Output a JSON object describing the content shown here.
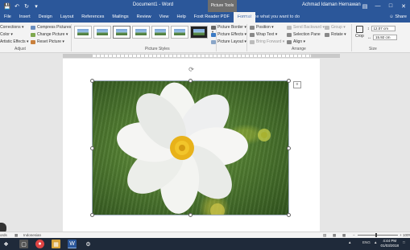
{
  "titlebar": {
    "doc_title": "Document1 - Word",
    "context_group": "Picture Tools",
    "user": "Achmad Idaman Hernawan",
    "qat_icons": [
      "save-icon",
      "undo-icon",
      "redo-icon"
    ],
    "win_minimize": "—",
    "win_maximize": "□",
    "win_close": "✕"
  },
  "tabs": [
    "File",
    "Insert",
    "Design",
    "Layout",
    "References",
    "Mailings",
    "Review",
    "View",
    "Help",
    "Foxit Reader PDF",
    "Format"
  ],
  "active_tab": "Format",
  "tell_me": "Tell me what you want to do",
  "share": "Share",
  "ribbon": {
    "adjust": {
      "corrections": "Corrections ▾",
      "color": "Color ▾",
      "artistic_effects": "Artistic Effects ▾",
      "compress": "Compress Pictures",
      "change": "Change Picture ▾",
      "reset": "Reset Picture ▾",
      "label": "Adjust"
    },
    "picture_styles": {
      "label": "Picture Styles",
      "picture_border": "Picture Border ▾",
      "picture_effects": "Picture Effects ▾",
      "picture_layout": "Picture Layout ▾"
    },
    "arrange": {
      "label": "Arrange",
      "position": "Position ▾",
      "wrap_text": "Wrap Text ▾",
      "bring_forward": "Bring Forward ▾",
      "send_backward": "Send Backward ▾",
      "selection_pane": "Selection Pane",
      "align": "Align ▾",
      "group": "Group ▾",
      "rotate": "Rotate ▾"
    },
    "size": {
      "label": "Size",
      "crop": "Crop",
      "height": "12.07 cm",
      "width": "15.92 cm"
    }
  },
  "status": {
    "words": "ords",
    "language": "Indonesian",
    "zoom": "100%"
  },
  "taskbar": {
    "time": "4:44 PM",
    "date": "01/03/2018",
    "lang": "ENG"
  }
}
